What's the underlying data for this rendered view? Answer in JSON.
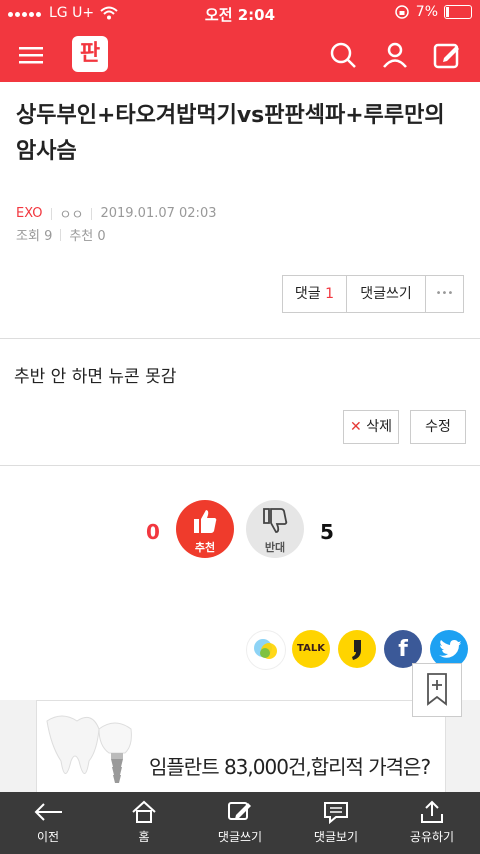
{
  "status": {
    "carrier": "LG U+",
    "time": "오전 2:04",
    "battery": "7%"
  },
  "header": {
    "logo": "판"
  },
  "post": {
    "title": "상두부인+타오겨밥먹기vs판판섹파+루루만의 암사슴",
    "author": "EXO",
    "nick": "ㅇㅇ",
    "date": "2019.01.07 02:03",
    "views_label": "조회",
    "views": "9",
    "recommend_label": "추천",
    "recommend": "0",
    "body": "추반 안 하면 뉴콘 못감"
  },
  "actions": {
    "comment_label": "댓글",
    "comment_count": "1",
    "write_comment": "댓글쓰기",
    "more": "•••"
  },
  "edit": {
    "delete": "삭제",
    "modify": "수정"
  },
  "vote": {
    "up_count": "0",
    "up_label": "추천",
    "down_label": "반대",
    "down_count": "5"
  },
  "share": {
    "kakaotalk": "TALK",
    "facebook": "f"
  },
  "ad": {
    "text": "임플란트 83,000건,합리적 가격은?"
  },
  "bottom": {
    "back": "이전",
    "home": "홈",
    "write": "댓글쓰기",
    "view": "댓글보기",
    "share": "공유하기"
  },
  "colors": {
    "brand": "#f2373f",
    "bottom_bar": "#3a3a3a"
  }
}
